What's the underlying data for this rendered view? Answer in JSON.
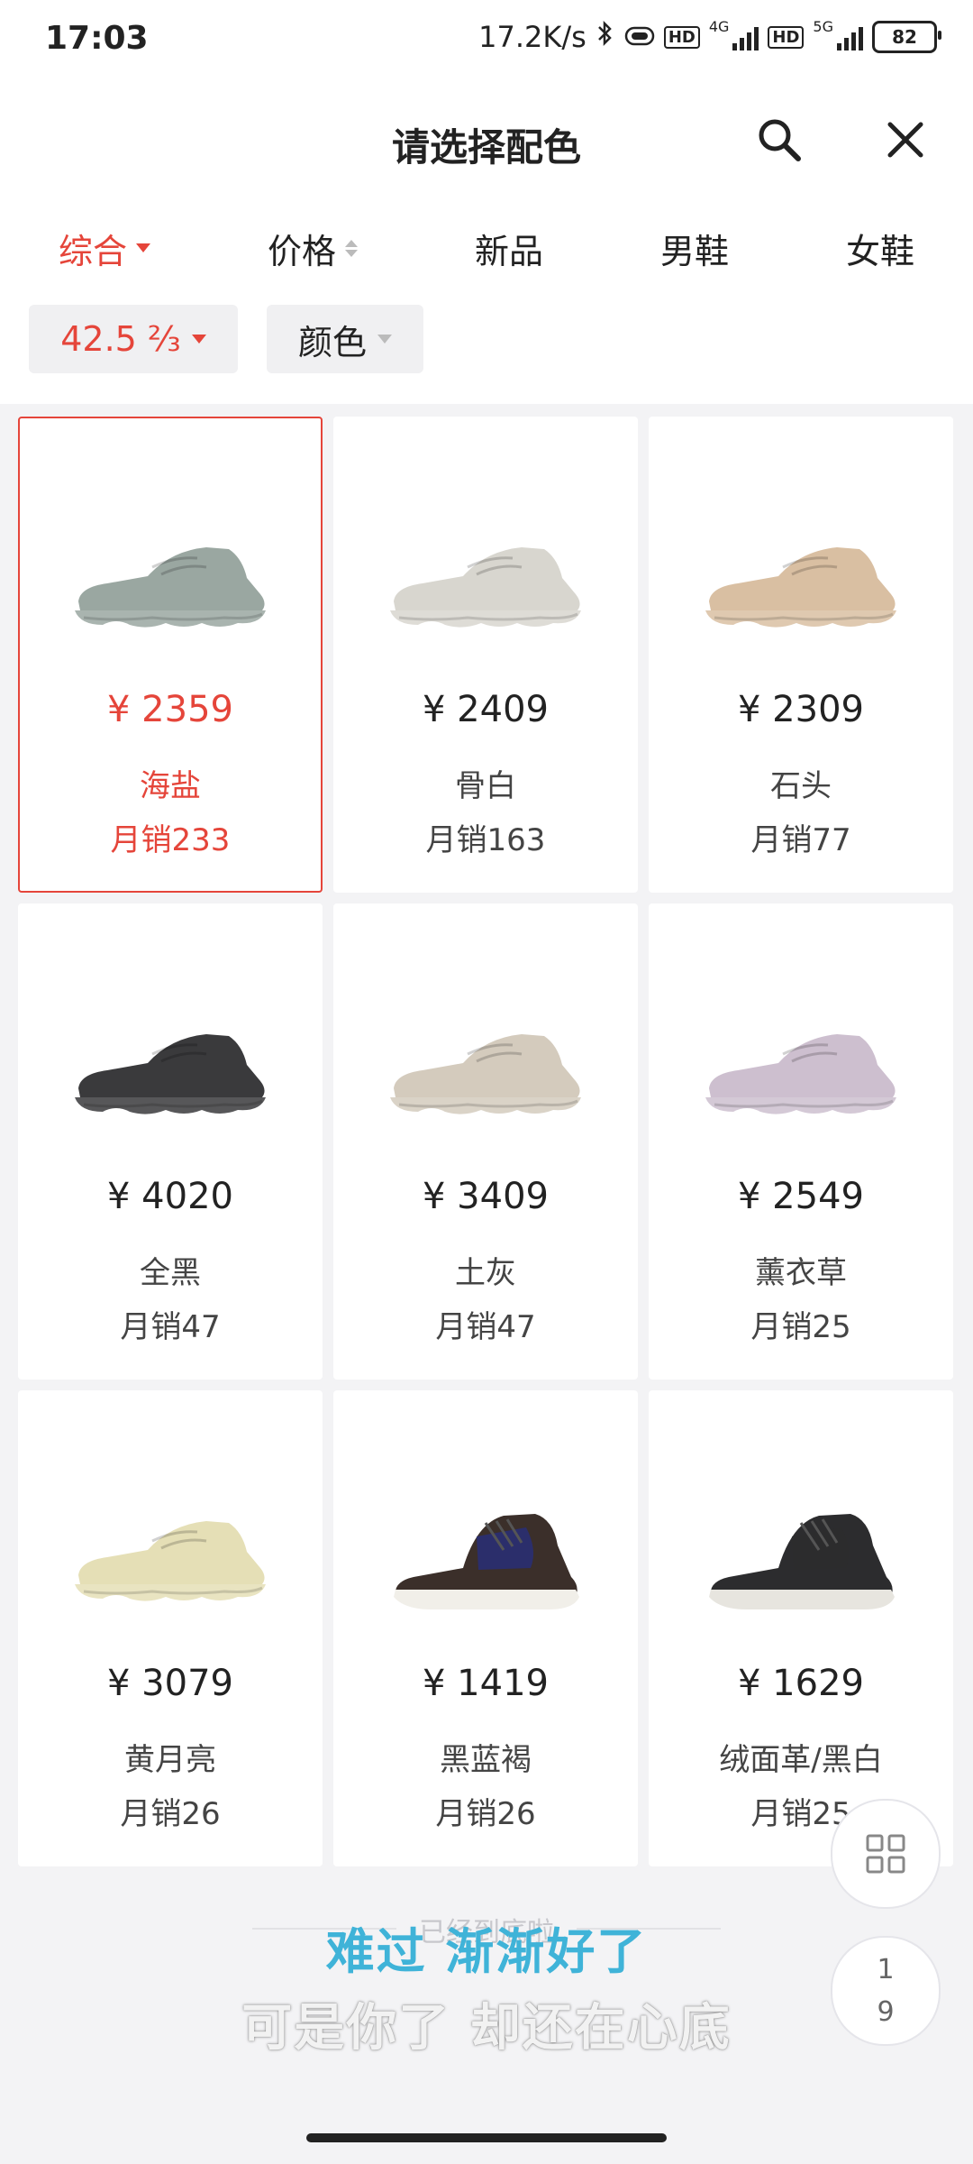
{
  "status_bar": {
    "time": "17:03",
    "net_speed": "17.2K/s",
    "net1_label": "4G",
    "net2_label": "5G",
    "battery": "82",
    "hd_label": "HD"
  },
  "header": {
    "title": "请选择配色",
    "search_icon": "search-icon",
    "close_icon": "close-icon"
  },
  "tabs": [
    {
      "label": "综合",
      "active": true
    },
    {
      "label": "价格",
      "sortable": true
    },
    {
      "label": "新品"
    },
    {
      "label": "男鞋"
    },
    {
      "label": "女鞋"
    }
  ],
  "filters": {
    "size": "42.5 ⅔",
    "color": "颜色"
  },
  "products": [
    {
      "price": "¥ 2359",
      "name": "海盐",
      "sales": "月销233",
      "selected": true,
      "color": "#9aa7a1"
    },
    {
      "price": "¥ 2409",
      "name": "骨白",
      "sales": "月销163",
      "color": "#d8d6cf"
    },
    {
      "price": "¥ 2309",
      "name": "石头",
      "sales": "月销77",
      "color": "#d9bfa2"
    },
    {
      "price": "¥ 4020",
      "name": "全黑",
      "sales": "月销47",
      "color": "#3a3a3c"
    },
    {
      "price": "¥ 3409",
      "name": "土灰",
      "sales": "月销47",
      "color": "#d4cbbd"
    },
    {
      "price": "¥ 2549",
      "name": "薰衣草",
      "sales": "月销25",
      "color": "#cdbfcf"
    },
    {
      "price": "¥ 3079",
      "name": "黄月亮",
      "sales": "月销26",
      "color": "#e5dfb6"
    },
    {
      "price": "¥ 1419",
      "name": "黑蓝褐",
      "sales": "月销26",
      "color": "#3b2f2a",
      "accent": "#2a2f72",
      "high": true
    },
    {
      "price": "¥ 1629",
      "name": "绒面革/黑白",
      "sales": "月销25",
      "color": "#2c2c2e",
      "sole": "#e7e5df",
      "high": true
    }
  ],
  "footer": {
    "end_text": "已经到底啦",
    "lyrics_line1": "难过 渐渐好了",
    "lyrics_line2": "可是你了 却还在心底",
    "page_current": "1",
    "page_total": "9",
    "grid_icon": "grid-icon"
  }
}
